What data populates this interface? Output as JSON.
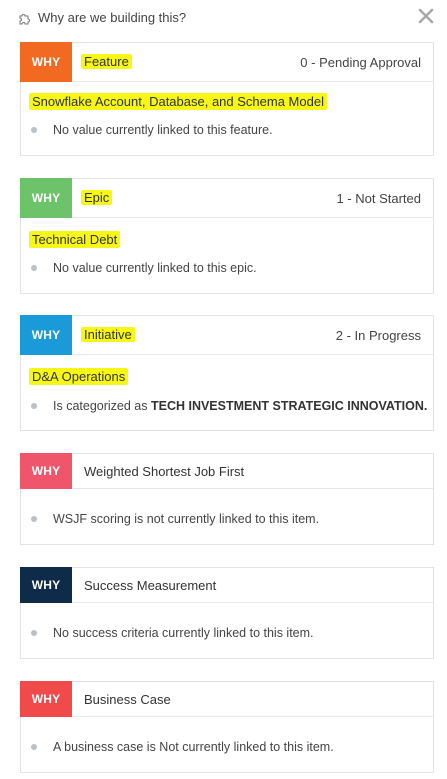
{
  "header": {
    "title": "Why are we building this?"
  },
  "why_label": "WHY",
  "colors": {
    "feature": "#f26a22",
    "epic": "#6cc36a",
    "initiative": "#1a9ad9",
    "wsjf": "#f0566b",
    "success": "#0f2b4a",
    "business": "#f04a4a",
    "highlight": "#f7f715"
  },
  "cards": [
    {
      "type": "Feature",
      "status": "0 - Pending Approval",
      "name": "Snowflake Account, Database, and Schema Model",
      "bullet": "No value currently linked to this feature."
    },
    {
      "type": "Epic",
      "status": "1 - Not Started",
      "name": "Technical Debt",
      "bullet": "No value currently linked to this epic."
    },
    {
      "type": "Initiative",
      "status": "2 - In Progress",
      "name": "D&A Operations",
      "bullet_prefix": "Is categorized as ",
      "bullet_bold": "TECH INVESTMENT STRATEGIC INNOVATION."
    },
    {
      "type": "Weighted Shortest Job First",
      "bullet": "WSJF scoring is not currently linked to this item."
    },
    {
      "type": "Success Measurement",
      "bullet": "No success criteria currently linked to this item."
    },
    {
      "type": "Business Case",
      "bullet": "A business case is Not currently linked to this item."
    }
  ]
}
